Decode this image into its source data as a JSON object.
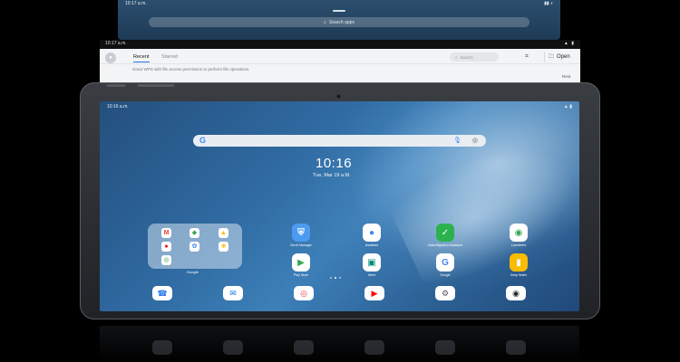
{
  "drawer": {
    "time": "10:17 a.m.",
    "search_placeholder": "Search apps"
  },
  "files": {
    "time": "10:17 a.m.",
    "tabs": [
      "Recent",
      "Starred"
    ],
    "hint": "Grant WPS with file access permission to perform file operations.",
    "search_placeholder": "Search",
    "open_label": "Open",
    "small_text": "Rest"
  },
  "home": {
    "status_time": "10:16 a.m.",
    "clock": "10:16",
    "date": "Tue, Mar 19 a.M.",
    "folder_label": "Google",
    "page_dots": 3,
    "apps": [
      {
        "label": "Scroll Manager",
        "icon": "shield-icon",
        "glyph": "⛨",
        "bg": "#4d9bf0",
        "fg": "#ffffff"
      },
      {
        "label": "Assistant",
        "icon": "assistant-icon",
        "glyph": "●",
        "bg": "#ffffff",
        "fg": "#4285f4"
      },
      {
        "label": "Data Migration Assistant",
        "icon": "migration-icon",
        "glyph": "✓",
        "bg": "#2bb24c",
        "fg": "#ffffff"
      },
      {
        "label": "Launchers",
        "icon": "launcher-icon",
        "glyph": "◉",
        "bg": "#ffffff",
        "fg": "#34a853"
      },
      {
        "label": "Play Store",
        "icon": "play-store-icon",
        "glyph": "▶",
        "bg": "#ffffff",
        "fg": "#34a853"
      },
      {
        "label": "Meet",
        "icon": "meet-icon",
        "glyph": "▣",
        "bg": "#ffffff",
        "fg": "#00897b"
      },
      {
        "label": "Google",
        "icon": "google-icon",
        "glyph": "G",
        "bg": "#ffffff",
        "fg": "#4285f4"
      },
      {
        "label": "Keep Notes",
        "icon": "keep-icon",
        "glyph": "▮",
        "bg": "#fbbc04",
        "fg": "#ffffff"
      }
    ],
    "dock": [
      {
        "icon": "phone-icon",
        "glyph": "☎",
        "fg": "#1a73e8"
      },
      {
        "icon": "messages-icon",
        "glyph": "✉",
        "fg": "#1a73e8"
      },
      {
        "icon": "chrome-icon",
        "glyph": "◎",
        "fg": "#ea4335"
      },
      {
        "icon": "youtube-icon",
        "glyph": "▶",
        "fg": "#ff0000"
      },
      {
        "icon": "settings-icon",
        "glyph": "⚙",
        "fg": "#555555"
      },
      {
        "icon": "camera-icon",
        "glyph": "◉",
        "fg": "#222222"
      }
    ],
    "folder_apps": [
      {
        "icon": "gmail-icon",
        "glyph": "M",
        "fg": "#ea4335"
      },
      {
        "icon": "maps-icon",
        "glyph": "◆",
        "fg": "#34a853"
      },
      {
        "icon": "drive-icon",
        "glyph": "▲",
        "fg": "#fbbc04"
      },
      {
        "icon": "youtube-music-icon",
        "glyph": "●",
        "fg": "#ff0000"
      },
      {
        "icon": "photos-icon",
        "glyph": "✿",
        "fg": "#4285f4"
      },
      {
        "icon": "photos-alt-icon",
        "glyph": "❀",
        "fg": "#fbbc04"
      },
      {
        "icon": "chrome-small-icon",
        "glyph": "◎",
        "fg": "#34a853"
      }
    ]
  }
}
